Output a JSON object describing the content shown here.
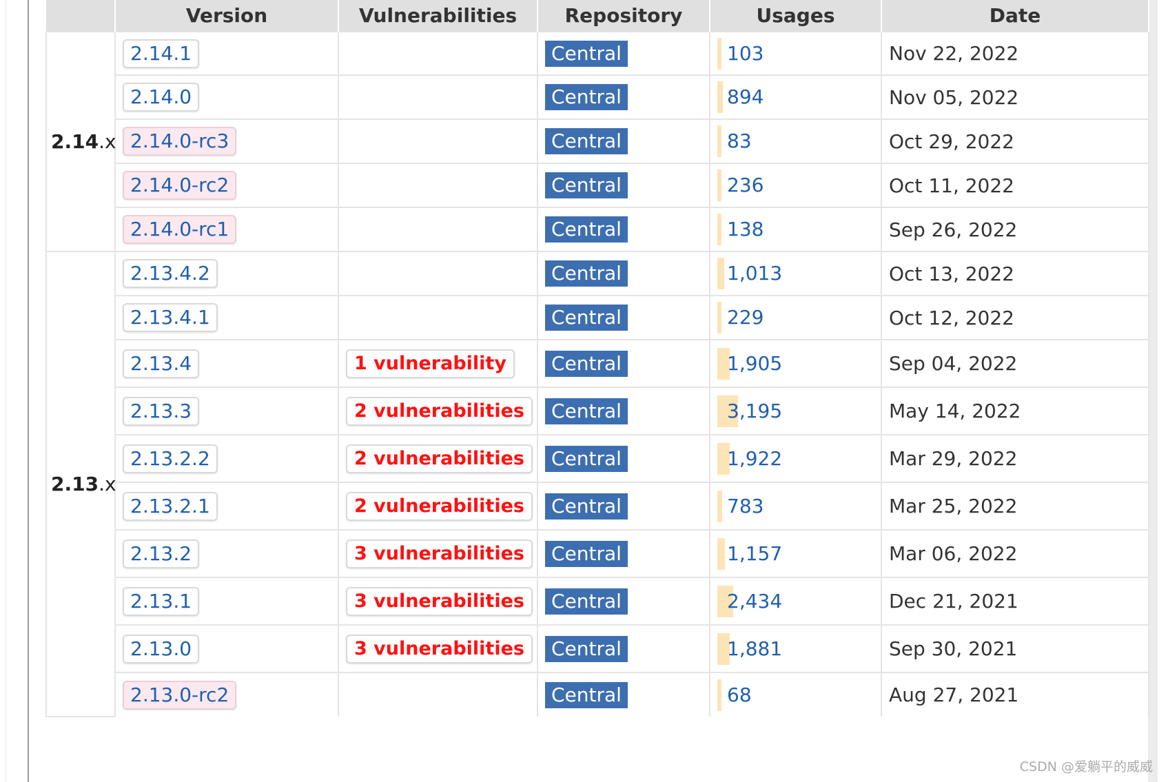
{
  "header": {
    "columns": [
      "Version",
      "Vulnerabilities",
      "Repository",
      "Usages",
      "Date"
    ]
  },
  "colors": {
    "version_link": "#1f5fae",
    "prerelease_bg": "#fce8ef",
    "vulnerability_text": "#ff1111",
    "repo_badge_bg": "#3d6fb0",
    "usage_bar": "#fde4b6",
    "header_bg": "#e0e0e0"
  },
  "usage_scale_max": 3195,
  "groups": [
    {
      "major": "2.14",
      "suffix": ".x",
      "rows": [
        {
          "version": "2.14.1",
          "prerelease": false,
          "vulnerabilities": "",
          "repository": "Central",
          "usages": "103",
          "usages_value": 103,
          "date": "Nov 22, 2022"
        },
        {
          "version": "2.14.0",
          "prerelease": false,
          "vulnerabilities": "",
          "repository": "Central",
          "usages": "894",
          "usages_value": 894,
          "date": "Nov 05, 2022"
        },
        {
          "version": "2.14.0-rc3",
          "prerelease": true,
          "vulnerabilities": "",
          "repository": "Central",
          "usages": "83",
          "usages_value": 83,
          "date": "Oct 29, 2022"
        },
        {
          "version": "2.14.0-rc2",
          "prerelease": true,
          "vulnerabilities": "",
          "repository": "Central",
          "usages": "236",
          "usages_value": 236,
          "date": "Oct 11, 2022"
        },
        {
          "version": "2.14.0-rc1",
          "prerelease": true,
          "vulnerabilities": "",
          "repository": "Central",
          "usages": "138",
          "usages_value": 138,
          "date": "Sep 26, 2022"
        }
      ]
    },
    {
      "major": "2.13",
      "suffix": ".x",
      "rows": [
        {
          "version": "2.13.4.2",
          "prerelease": false,
          "vulnerabilities": "",
          "repository": "Central",
          "usages": "1,013",
          "usages_value": 1013,
          "date": "Oct 13, 2022"
        },
        {
          "version": "2.13.4.1",
          "prerelease": false,
          "vulnerabilities": "",
          "repository": "Central",
          "usages": "229",
          "usages_value": 229,
          "date": "Oct 12, 2022"
        },
        {
          "version": "2.13.4",
          "prerelease": false,
          "vulnerabilities": "1 vulnerability",
          "repository": "Central",
          "usages": "1,905",
          "usages_value": 1905,
          "date": "Sep 04, 2022"
        },
        {
          "version": "2.13.3",
          "prerelease": false,
          "vulnerabilities": "2 vulnerabilities",
          "repository": "Central",
          "usages": "3,195",
          "usages_value": 3195,
          "date": "May 14, 2022"
        },
        {
          "version": "2.13.2.2",
          "prerelease": false,
          "vulnerabilities": "2 vulnerabilities",
          "repository": "Central",
          "usages": "1,922",
          "usages_value": 1922,
          "date": "Mar 29, 2022"
        },
        {
          "version": "2.13.2.1",
          "prerelease": false,
          "vulnerabilities": "2 vulnerabilities",
          "repository": "Central",
          "usages": "783",
          "usages_value": 783,
          "date": "Mar 25, 2022"
        },
        {
          "version": "2.13.2",
          "prerelease": false,
          "vulnerabilities": "3 vulnerabilities",
          "repository": "Central",
          "usages": "1,157",
          "usages_value": 1157,
          "date": "Mar 06, 2022"
        },
        {
          "version": "2.13.1",
          "prerelease": false,
          "vulnerabilities": "3 vulnerabilities",
          "repository": "Central",
          "usages": "2,434",
          "usages_value": 2434,
          "date": "Dec 21, 2021"
        },
        {
          "version": "2.13.0",
          "prerelease": false,
          "vulnerabilities": "3 vulnerabilities",
          "repository": "Central",
          "usages": "1,881",
          "usages_value": 1881,
          "date": "Sep 30, 2021"
        },
        {
          "version": "2.13.0-rc2",
          "prerelease": true,
          "vulnerabilities": "",
          "repository": "Central",
          "usages": "68",
          "usages_value": 68,
          "date": "Aug 27, 2021"
        }
      ]
    }
  ],
  "watermark": "CSDN @爱躺平的威威"
}
